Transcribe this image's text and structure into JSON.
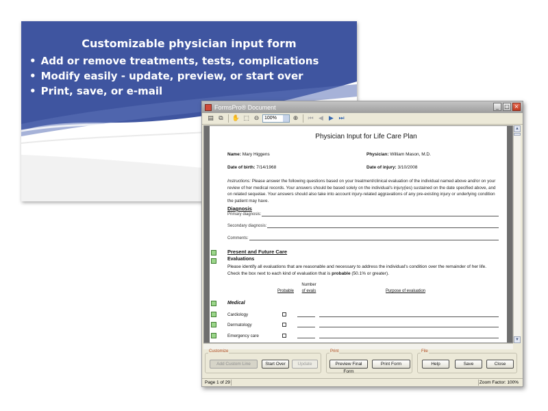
{
  "slide": {
    "title": "Customizable physician input form",
    "bullets": [
      "Add or remove treatments, tests, complications",
      "Modify easily - update, preview, or start over",
      "Print, save, or e-mail"
    ],
    "colors": {
      "band": "#3f55a0",
      "text": "#ffffff"
    }
  },
  "window": {
    "title": "FormsPro® Document",
    "toolbar": {
      "zoom": "100%"
    },
    "statusbar": {
      "page": "Page 1 of 29",
      "zoom_factor": "Zoom Factor: 100%"
    }
  },
  "document": {
    "title": "Physician Input for Life Care Plan",
    "name_label": "Name:",
    "name_value": "Mary Higgens",
    "physician_label": "Physician:",
    "physician_value": "William Mason, M.D.",
    "dob_label": "Date of birth:",
    "dob_value": "7/14/1968",
    "doi_label": "Date of injury:",
    "doi_value": "3/10/2008",
    "instructions_label": "Instructions:",
    "instructions_text": " Please answer the following questions based on your treatment/clinical evaluation of the individual named above and/or on your review of her medical records. Your answers should be based solely on the individual's injury(ies) sustained on the date specified above, and on related sequelae. Your answers should also take into account injury-related aggravations of any pre-existing injury or underlying condition the patient may have.",
    "diagnosis_heading": "Diagnosis",
    "primary_diagnosis": "Primary diagnosis:",
    "secondary_diagnosis": "Secondary diagnosis:",
    "comments": "Comments:",
    "present_future_heading": "Present and Future Care",
    "evaluations_heading": "Evaluations",
    "evaluations_text_a": "Please identify all evaluations that are reasonable and necessary to address the individual's condition over the remainder of her life. Check the box next to each kind of evaluation that is ",
    "evaluations_text_bold": "probable",
    "evaluations_text_b": " (50.1% or greater).",
    "col_probable": "Probable",
    "col_number_top": "Number",
    "col_number_bottom": "of evals",
    "col_purpose": "Purpose of evaluation",
    "medical_heading": "Medical",
    "evaluations": [
      {
        "label": "Cardiology"
      },
      {
        "label": "Dermatology"
      },
      {
        "label": "Emergency care"
      }
    ]
  },
  "panel": {
    "customize": {
      "label": "Customize",
      "add_custom_line": "Add Custom Line",
      "start_over": "Start Over",
      "update": "Update"
    },
    "print": {
      "label": "Print",
      "preview_final_form": "Preview Final Form",
      "print_form": "Print Form"
    },
    "file": {
      "label": "File",
      "help": "Help",
      "save": "Save",
      "close": "Close"
    }
  }
}
